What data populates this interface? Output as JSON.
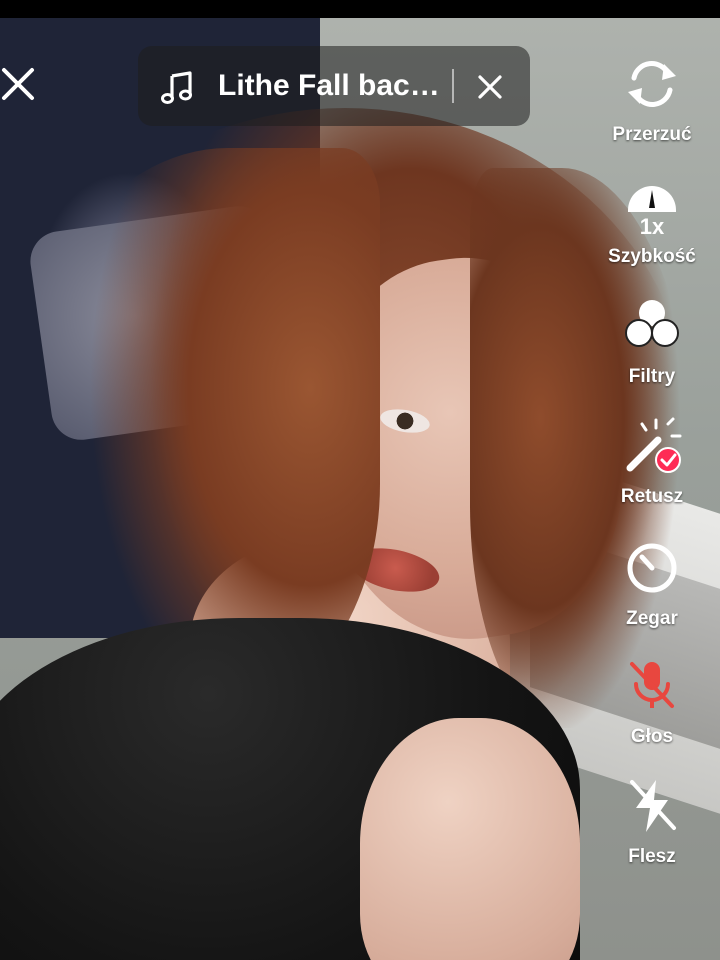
{
  "music_bar": {
    "title": "Lithe Fall bac…",
    "icon": "music-note-icon",
    "close_icon": "close-icon"
  },
  "camera": {
    "close_icon": "close-icon"
  },
  "toolbar": {
    "items": [
      {
        "label": "Przerzuć",
        "icon": "flip-camera-icon"
      },
      {
        "label": "Szybkość",
        "icon": "speed-icon",
        "badge": "1x"
      },
      {
        "label": "Filtry",
        "icon": "filters-icon"
      },
      {
        "label": "Retusz",
        "icon": "beauty-icon"
      },
      {
        "label": "Zegar",
        "icon": "timer-icon"
      },
      {
        "label": "Głos",
        "icon": "mic-off-icon"
      },
      {
        "label": "Flesz",
        "icon": "flash-off-icon"
      }
    ]
  },
  "colors": {
    "accent_red": "#fe2c55",
    "mic_off_red": "#e8473f",
    "text": "#ffffff"
  }
}
